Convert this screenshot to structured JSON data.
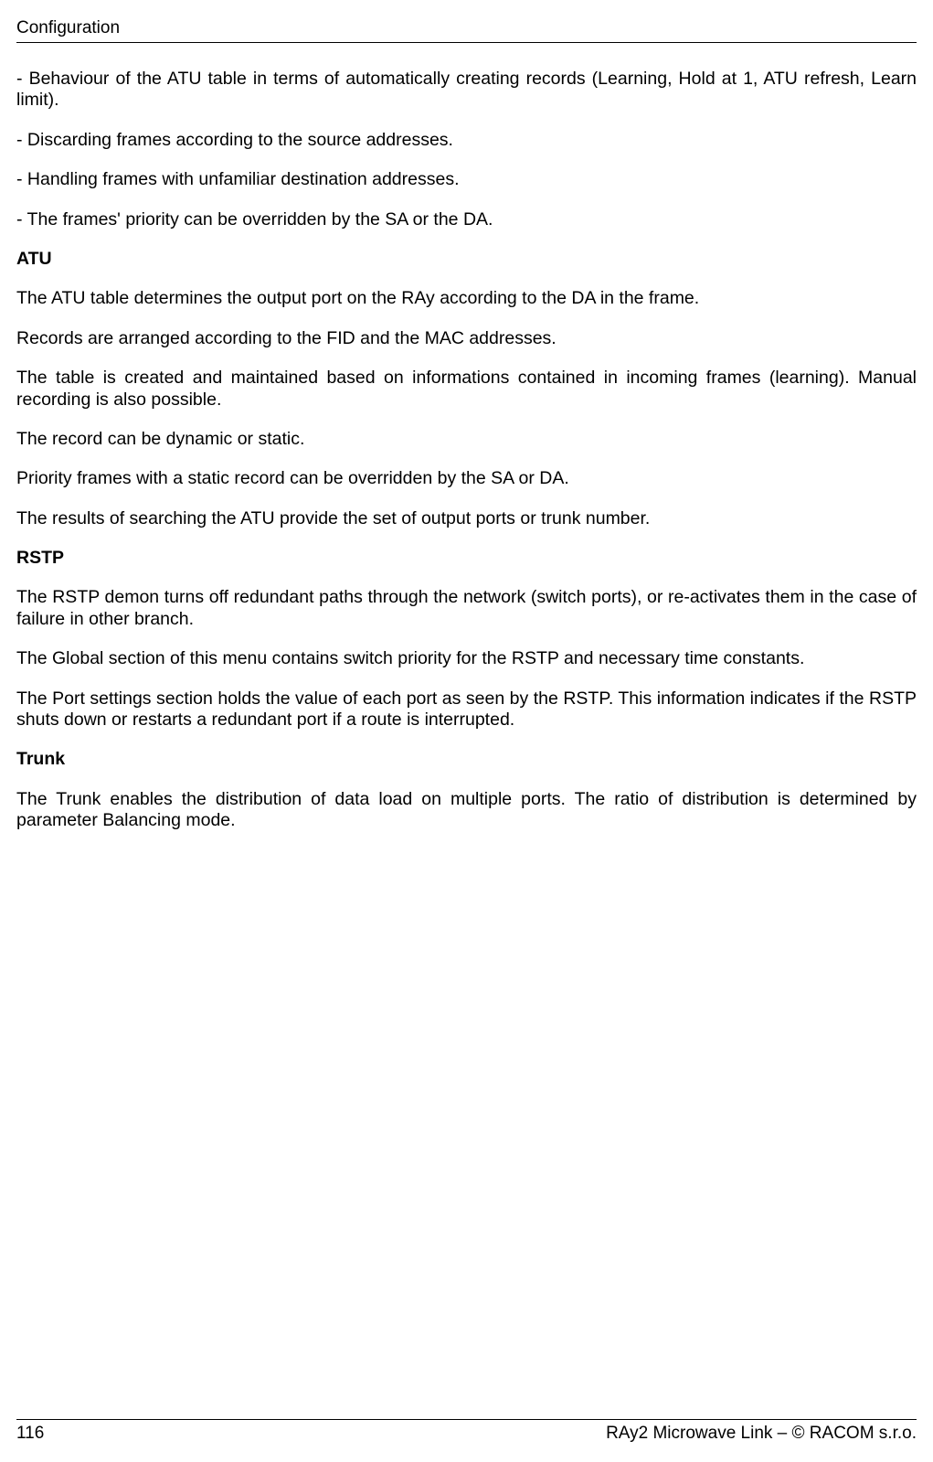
{
  "header": {
    "title": "Configuration"
  },
  "body": {
    "p1": "- Behaviour of the ATU table in terms of automatically creating records (Learning, Hold at 1, ATU refresh, Learn limit).",
    "p2": "- Discarding frames according to the source addresses.",
    "p3": "- Handling frames with unfamiliar destination addresses.",
    "p4": "- The frames' priority can be overridden by the SA or the DA.",
    "h1": "ATU",
    "p5": "The ATU table determines the output port on the RAy according to the DA in the frame.",
    "p6": "Records are arranged according to the FID and the MAC addresses.",
    "p7": "The table is created and maintained based on informations contained in incoming frames (learning). Manual recording is also possible.",
    "p8": "The record can be dynamic or static.",
    "p9": "Priority frames with a static record can be overridden by the SA or DA.",
    "p10": "The results of searching the ATU provide the set of output ports or trunk number.",
    "h2": "RSTP",
    "p11": "The RSTP demon turns off redundant paths through the network (switch ports), or re-activates them in the case of failure in other branch.",
    "p12": "The Global section of this menu contains switch priority for the RSTP and necessary time constants.",
    "p13": "The Port settings section holds the value of each port as seen by the RSTP. This information indicates if the RSTP shuts down or restarts a redundant port if a route is interrupted.",
    "h3": "Trunk",
    "p14": "The Trunk enables the distribution of data load on multiple ports. The ratio of distribution is determined by parameter Balancing mode."
  },
  "footer": {
    "page_number": "116",
    "source": "RAy2 Microwave Link – © RACOM s.r.o."
  }
}
